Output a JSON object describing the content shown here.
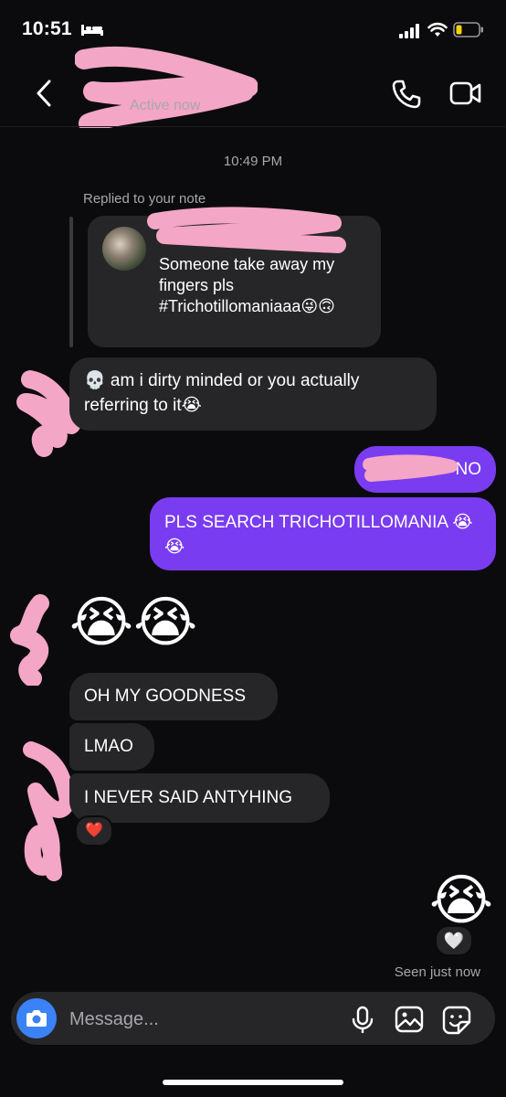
{
  "status_bar": {
    "time": "10:51"
  },
  "header": {
    "status": "Active now"
  },
  "conversation": {
    "timestamp": "10:49 PM",
    "reply_label": "Replied to your note",
    "note_text": "Someone take away my fingers pls #Trichotillomaniaaa😜🙃",
    "messages": [
      {
        "side": "in",
        "text": "💀 am i dirty minded or you actually referring to it😭"
      },
      {
        "side": "out",
        "text": "NO"
      },
      {
        "side": "out",
        "text": "PLS SEARCH TRICHOTILLOMANIA 😭😭"
      },
      {
        "side": "in",
        "text": "😭😭"
      },
      {
        "side": "in",
        "text": "OH MY GOODNESS"
      },
      {
        "side": "in",
        "text": "LMAO"
      },
      {
        "side": "in",
        "text": "I NEVER SAID ANTYHING"
      },
      {
        "side": "out",
        "text": "😭"
      }
    ],
    "reactions": {
      "heart": "❤️",
      "white_heart": "🤍"
    },
    "seen": "Seen just now"
  },
  "composer": {
    "placeholder": "Message..."
  },
  "colors": {
    "outgoing_bubble": "#7a3cf0",
    "incoming_bubble": "#262629",
    "camera_button": "#3b82f6",
    "scribble": "#f4a6c6"
  }
}
